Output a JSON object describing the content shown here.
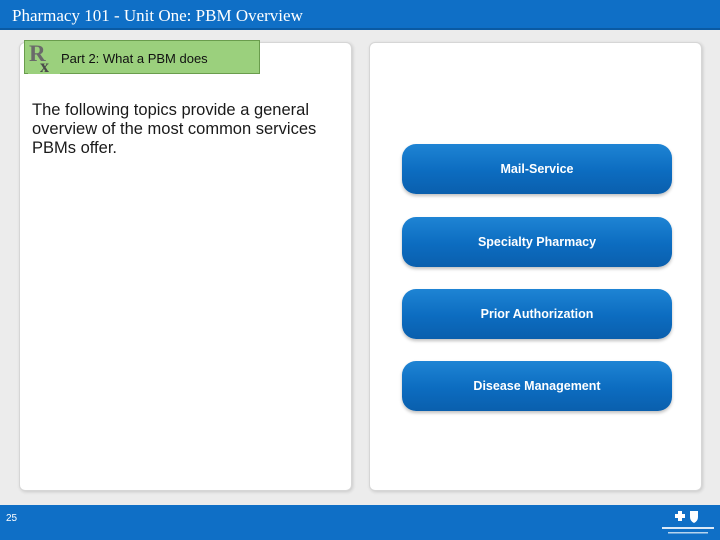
{
  "header": {
    "title": "Pharmacy 101 - Unit One: PBM Overview"
  },
  "section": {
    "tab_label": "Part 2: What a PBM does",
    "logo_icon": "rx-icon",
    "tab_color": "#9bd07d"
  },
  "intro": {
    "text": "The following topics provide a general overview of the most common services PBMs offer."
  },
  "topics": [
    {
      "label": "Mail-Service"
    },
    {
      "label": "Specialty Pharmacy"
    },
    {
      "label": "Prior Authorization"
    },
    {
      "label": "Disease Management"
    }
  ],
  "footer": {
    "page_number": "25",
    "logo_icon": "bcbs-logo-icon"
  },
  "colors": {
    "brand_blue": "#0f6fc6",
    "button_blue": "#0c6cc0",
    "background": "#ececec"
  }
}
